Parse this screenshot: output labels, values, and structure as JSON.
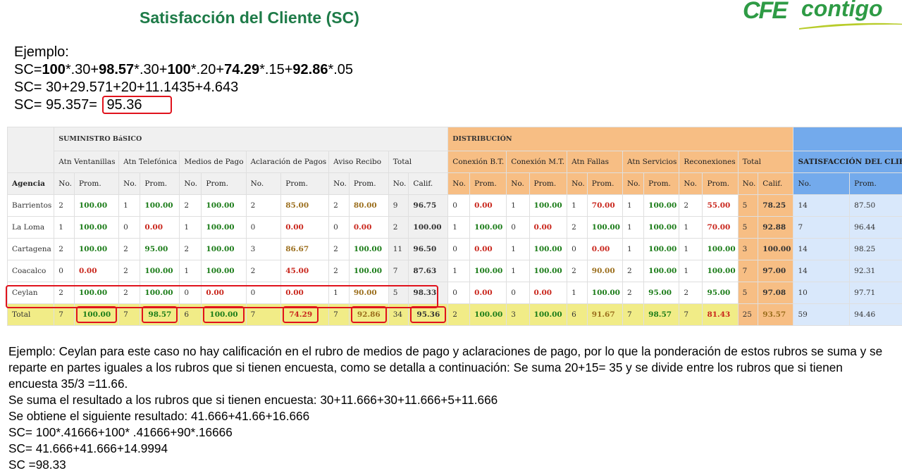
{
  "title": "Satisfacción del Cliente (SC)",
  "logo": {
    "cfe": "CFE",
    "contigo": "contigo"
  },
  "example": {
    "label": "Ejemplo:",
    "formula": [
      {
        "t": "SC=",
        "b": false
      },
      {
        "t": "100",
        "b": true
      },
      {
        "t": "*.30+",
        "b": false
      },
      {
        "t": "98.57",
        "b": true
      },
      {
        "t": "*.30+",
        "b": false
      },
      {
        "t": "100",
        "b": true
      },
      {
        "t": "*.20+",
        "b": false
      },
      {
        "t": "74.29",
        "b": true
      },
      {
        "t": "*.15+",
        "b": false
      },
      {
        "t": "92.86",
        "b": true
      },
      {
        "t": "*.05",
        "b": false
      }
    ],
    "line3": "SC= 30+29.571+20+11.1435+4.643",
    "line4_prefix": "SC= 95.357=",
    "line4_result": "95.36"
  },
  "table": {
    "groups": {
      "suministro": "SUMINISTRO BáSICO",
      "distribucion": "DISTRIBUCIÓN",
      "satisfaccion": "SATISFACCIÓN DEL CLIENTE"
    },
    "subheaders": [
      "Atn Ventanillas",
      "Atn Telefónica",
      "Medios de Pago",
      "Aclaración de Pagos",
      "Aviso Recibo",
      "Total",
      "Conexión B.T.",
      "Conexión M.T.",
      "Atn Fallas",
      "Atn Servicios",
      "Reconexiones",
      "Total"
    ],
    "agencia_label": "Agencia",
    "col_labels": [
      "No.",
      "Prom.",
      "No.",
      "Prom.",
      "No.",
      "Prom.",
      "No.",
      "Prom.",
      "No.",
      "Prom.",
      "No.",
      "Calif.",
      "No.",
      "Prom.",
      "No.",
      "Prom.",
      "No.",
      "Prom.",
      "No.",
      "Prom.",
      "No.",
      "Prom.",
      "No.",
      "Calif.",
      "No.",
      "Prom."
    ],
    "rows": [
      {
        "agencia": "Barrientos",
        "v": [
          "2",
          "100.00",
          "1",
          "100.00",
          "2",
          "100.00",
          "2",
          "85.00",
          "2",
          "80.00",
          "9",
          "96.75",
          "0",
          "0.00",
          "1",
          "100.00",
          "1",
          "70.00",
          "1",
          "100.00",
          "2",
          "55.00",
          "5",
          "78.25",
          "14",
          "87.50"
        ]
      },
      {
        "agencia": "La Loma",
        "v": [
          "1",
          "100.00",
          "0",
          "0.00",
          "1",
          "100.00",
          "0",
          "0.00",
          "0",
          "0.00",
          "2",
          "100.00",
          "1",
          "100.00",
          "0",
          "0.00",
          "2",
          "100.00",
          "1",
          "100.00",
          "1",
          "70.00",
          "5",
          "92.88",
          "7",
          "96.44"
        ]
      },
      {
        "agencia": "Cartagena",
        "v": [
          "2",
          "100.00",
          "2",
          "95.00",
          "2",
          "100.00",
          "3",
          "86.67",
          "2",
          "100.00",
          "11",
          "96.50",
          "0",
          "0.00",
          "1",
          "100.00",
          "0",
          "0.00",
          "1",
          "100.00",
          "1",
          "100.00",
          "3",
          "100.00",
          "14",
          "98.25"
        ]
      },
      {
        "agencia": "Coacalco",
        "v": [
          "0",
          "0.00",
          "2",
          "100.00",
          "1",
          "100.00",
          "2",
          "45.00",
          "2",
          "100.00",
          "7",
          "87.63",
          "1",
          "100.00",
          "1",
          "100.00",
          "2",
          "90.00",
          "2",
          "100.00",
          "1",
          "100.00",
          "7",
          "97.00",
          "14",
          "92.31"
        ]
      },
      {
        "agencia": "Ceylan",
        "v": [
          "2",
          "100.00",
          "2",
          "100.00",
          "0",
          "0.00",
          "0",
          "0.00",
          "1",
          "90.00",
          "5",
          "98.33",
          "0",
          "0.00",
          "0",
          "0.00",
          "1",
          "100.00",
          "2",
          "95.00",
          "2",
          "95.00",
          "5",
          "97.08",
          "10",
          "97.71"
        ]
      }
    ],
    "total": {
      "agencia": "Total",
      "v": [
        "7",
        "100.00",
        "7",
        "98.57",
        "6",
        "100.00",
        "7",
        "74.29",
        "7",
        "92.86",
        "34",
        "95.36",
        "2",
        "100.00",
        "3",
        "100.00",
        "6",
        "91.67",
        "7",
        "98.57",
        "7",
        "81.43",
        "25",
        "93.57",
        "59",
        "94.46"
      ]
    }
  },
  "explanation": {
    "p1": "Ejemplo: Ceylan para este caso no hay calificación en el rubro de medios de pago y aclaraciones de pago, por lo que la ponderación de estos rubros se suma y se reparte en partes iguales a los rubros que si tienen encuesta, como se detalla a continuación: Se suma 20+15= 35 y se divide entre los rubros que si tienen encuesta  35/3 =11.66.",
    "l2": "Se suma el resultado a los rubros que si tienen encuesta:  30+11.666+30+11.666+5+11.666",
    "l3": "Se obtiene el siguiente resultado: 41.666+41.66+16.666",
    "l4": "SC= 100*.41666+100* .41666+90*.16666",
    "l5": "SC= 41.666+41.666+14.9994",
    "l6": "SC =98.33"
  }
}
